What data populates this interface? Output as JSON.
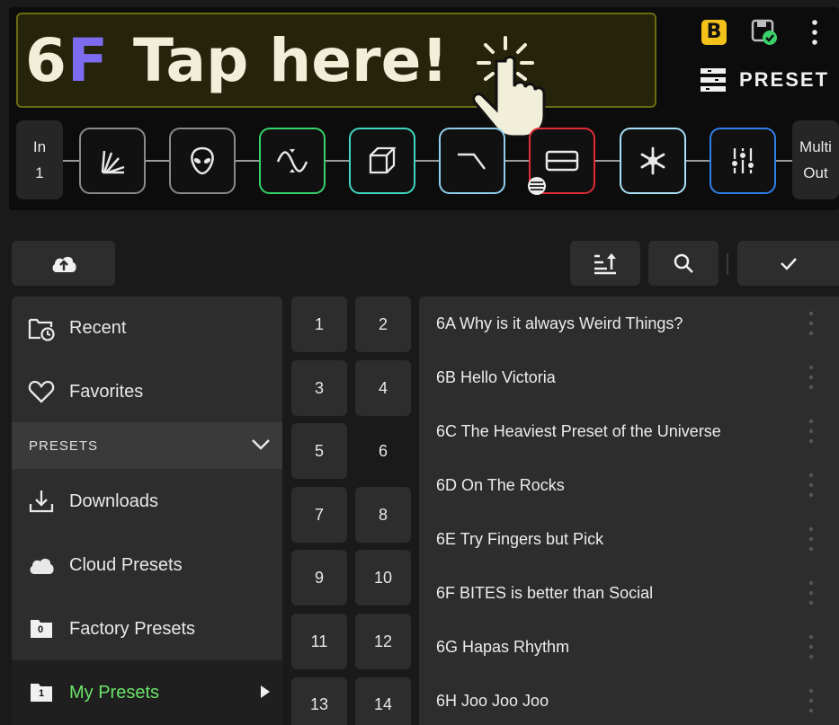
{
  "header": {
    "preset_number": "6",
    "preset_bank": "F",
    "preset_name": "Tap here!",
    "bank_badge": "B",
    "preset_label": "PRESET"
  },
  "chain": {
    "input": {
      "line1": "In",
      "line2": "1"
    },
    "output": {
      "line1": "Multi",
      "line2": "Out"
    },
    "blocks": [
      {
        "icon": "pedal-board-icon",
        "color": "#8a8a8a"
      },
      {
        "icon": "alien-icon",
        "color": "#8a8a8a"
      },
      {
        "icon": "modulation-wave-icon",
        "color": "#35d46a"
      },
      {
        "icon": "cube-icon",
        "color": "#3fd8c4"
      },
      {
        "icon": "filter-curve-icon",
        "color": "#8fd0f0"
      },
      {
        "icon": "eq-rect-icon",
        "color": "#e02c35"
      },
      {
        "icon": "snowflake-icon",
        "color": "#a8e0f8"
      },
      {
        "icon": "sliders-icon",
        "color": "#2f7fe8"
      }
    ]
  },
  "toolbar": {
    "upload_icon": "cloud-upload-icon",
    "sort_icon": "sort-icon",
    "search_icon": "search-icon",
    "confirm_icon": "check-icon"
  },
  "sidebar": {
    "recent": "Recent",
    "favorites": "Favorites",
    "section_header": "PRESETS",
    "downloads": "Downloads",
    "cloud": "Cloud Presets",
    "factory": "Factory Presets",
    "factory_badge": "0",
    "my": "My Presets",
    "my_badge": "1"
  },
  "banks": [
    "1",
    "2",
    "3",
    "4",
    "5",
    "6",
    "7",
    "8",
    "9",
    "10",
    "11",
    "12",
    "13",
    "14"
  ],
  "selected_bank": "6",
  "presets": [
    "6A Why is it always Weird Things?",
    "6B Hello Victoria",
    "6C The Heaviest Preset of the Universe",
    "6D On The Rocks",
    "6E Try Fingers but Pick",
    "6F BITES is better than Social",
    "6G Hapas Rhythm",
    "6H Joo Joo Joo"
  ],
  "colors": {
    "accent_green": "#6be36a",
    "bank_purple": "#7d6cf0",
    "name_box_border": "#6c6a14"
  }
}
